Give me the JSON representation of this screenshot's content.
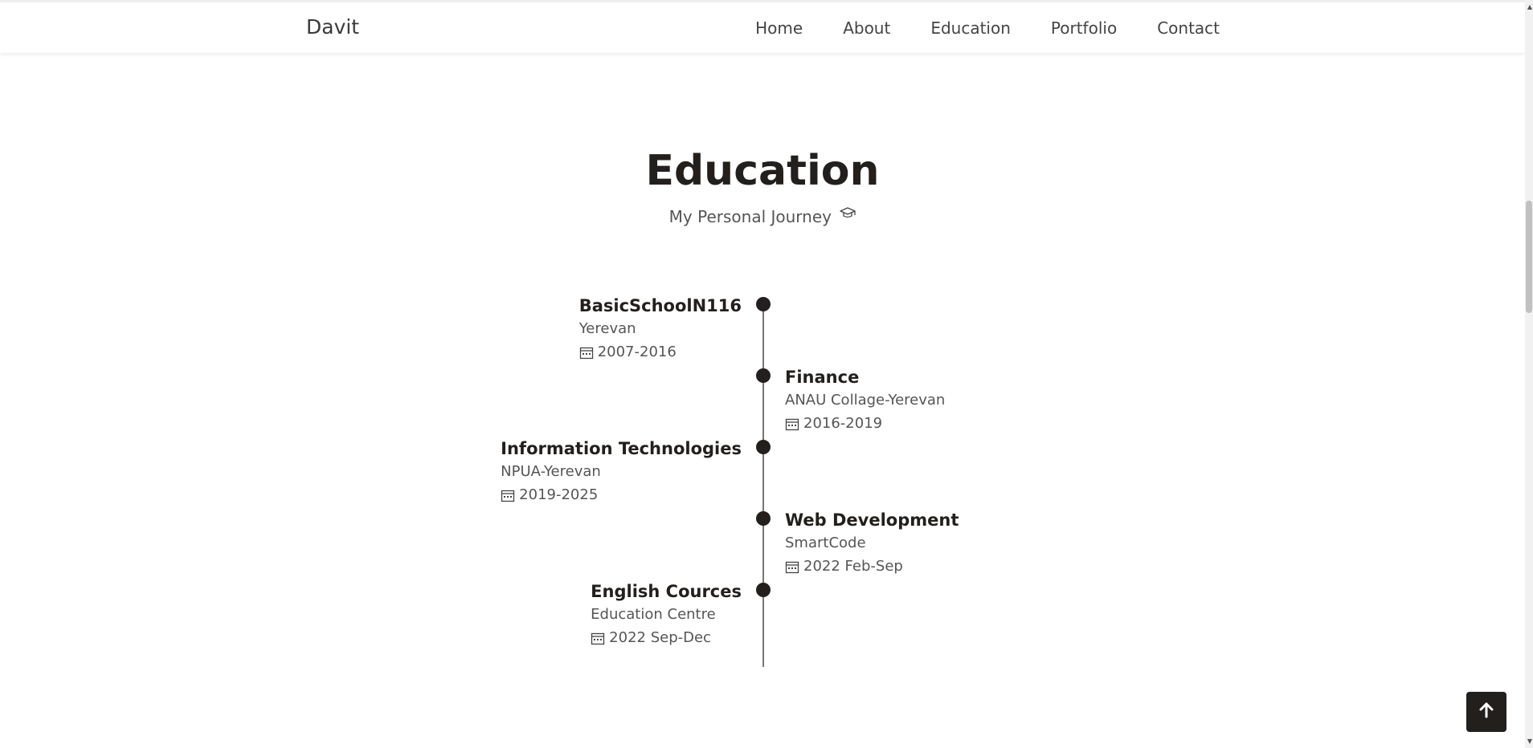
{
  "navbar": {
    "brand": "Davit",
    "links": [
      "Home",
      "About",
      "Education",
      "Portfolio",
      "Contact"
    ]
  },
  "section": {
    "title": "Education",
    "subtitle": "My Personal Journey",
    "subtitle_icon": "graduation-cap-icon"
  },
  "timeline": {
    "entries": [
      {
        "title": "BasicSchoolN116",
        "org": "Yerevan",
        "date": "2007-2016",
        "side": "left"
      },
      {
        "title": "Finance",
        "org": "ANAU Collage-Yerevan",
        "date": "2016-2019",
        "side": "right"
      },
      {
        "title": "Information Technologies",
        "org": "NPUA-Yerevan",
        "date": "2019-2025",
        "side": "left"
      },
      {
        "title": "Web Development",
        "org": "SmartCode",
        "date": "2022 Feb-Sep",
        "side": "right"
      },
      {
        "title": "English Cources",
        "org": "Education Centre",
        "date": "2022 Sep-Dec",
        "side": "left"
      }
    ]
  },
  "colors": {
    "accent": "#221f1c",
    "text": "#555555",
    "line": "#777777"
  },
  "scroll_top_icon": "arrow-up-icon"
}
